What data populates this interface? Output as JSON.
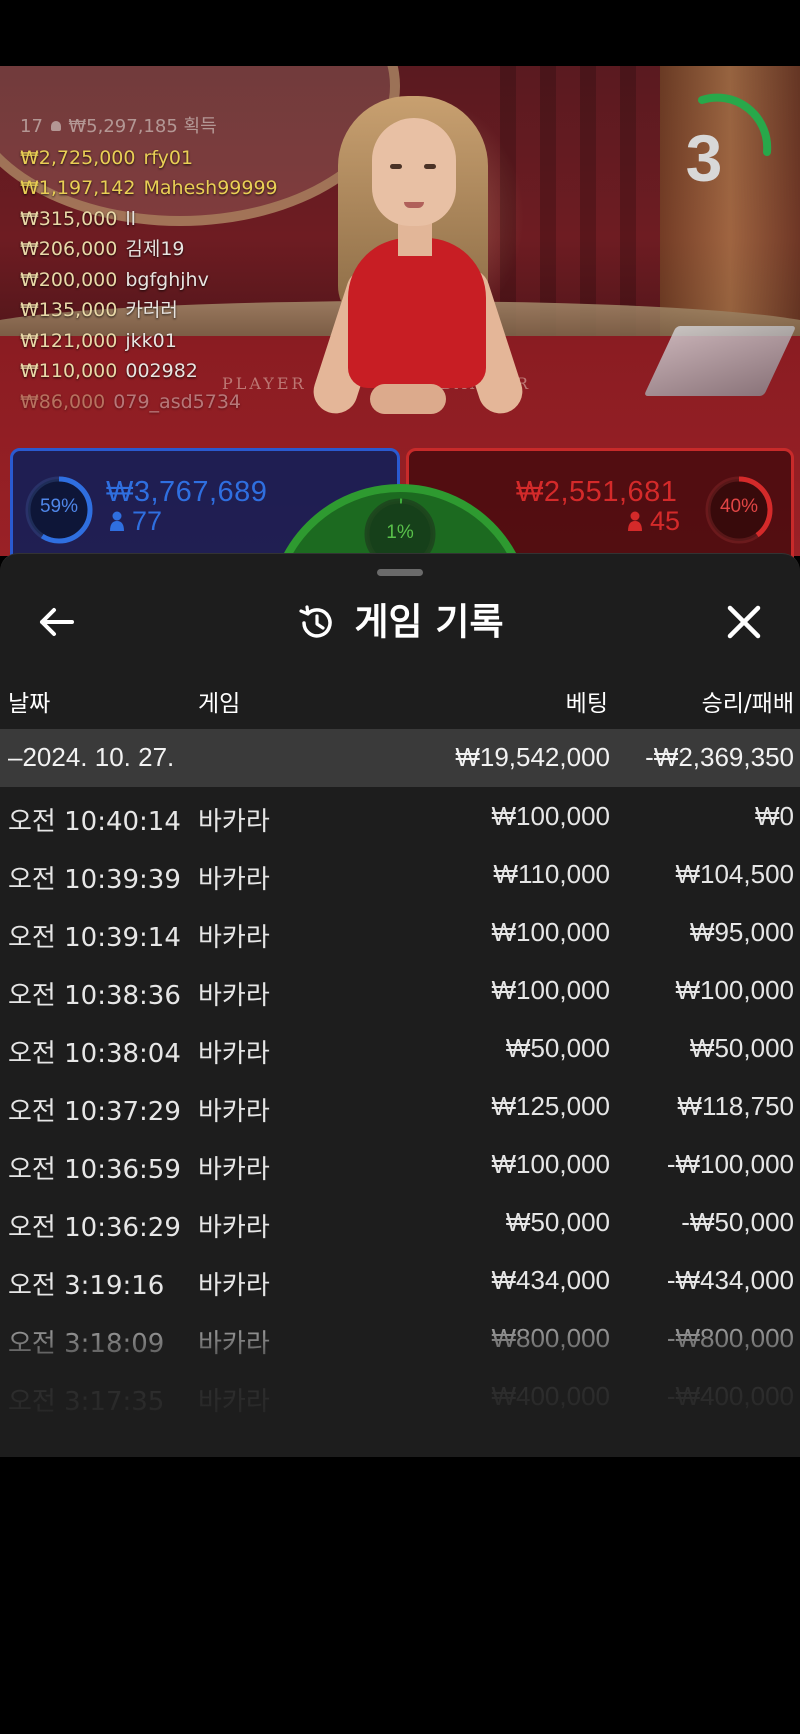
{
  "stream": {
    "timer_value": "3",
    "felt_player": "PLAYER",
    "felt_banker": "BANKER",
    "bets_header": {
      "count": "17",
      "total": "₩5,297,185",
      "suffix": "획득"
    },
    "bets": [
      {
        "amount": "₩2,725,000",
        "name": "rfy01",
        "highlight": true
      },
      {
        "amount": "₩1,197,142",
        "name": "Mahesh99999",
        "highlight": true
      },
      {
        "amount": "₩315,000",
        "name": "ll",
        "highlight": false
      },
      {
        "amount": "₩206,000",
        "name": "김제19",
        "highlight": false
      },
      {
        "amount": "₩200,000",
        "name": "bgfghjhv",
        "highlight": false
      },
      {
        "amount": "₩135,000",
        "name": "카러러",
        "highlight": false
      },
      {
        "amount": "₩121,000",
        "name": "jkk01",
        "highlight": false
      },
      {
        "amount": "₩110,000",
        "name": "002982",
        "highlight": false
      },
      {
        "amount": "₩86,000",
        "name": "079_asd5734",
        "highlight": false
      }
    ],
    "player": {
      "percent": "59%",
      "percent_value": 59,
      "amount": "₩3,767,689",
      "count": "77",
      "color": "#2f6fe0"
    },
    "banker": {
      "percent": "40%",
      "percent_value": 40,
      "amount": "₩2,551,681",
      "count": "45",
      "color": "#d42a2a"
    },
    "tie": {
      "percent": "1%",
      "percent_value": 1,
      "color": "#3fae3a"
    }
  },
  "sheet": {
    "title": "게임 기록",
    "columns": {
      "date": "날짜",
      "game": "게임",
      "bet": "베팅",
      "win_loss": "승리/패배"
    },
    "day": {
      "date": "–2024. 10. 27.",
      "bet": "₩19,542,000",
      "win_loss": "-₩2,369,350"
    },
    "records": [
      {
        "time": "오전 10:40:14",
        "game": "바카라",
        "bet": "₩100,000",
        "win_loss": "₩0"
      },
      {
        "time": "오전 10:39:39",
        "game": "바카라",
        "bet": "₩110,000",
        "win_loss": "₩104,500"
      },
      {
        "time": "오전 10:39:14",
        "game": "바카라",
        "bet": "₩100,000",
        "win_loss": "₩95,000"
      },
      {
        "time": "오전 10:38:36",
        "game": "바카라",
        "bet": "₩100,000",
        "win_loss": "₩100,000"
      },
      {
        "time": "오전 10:38:04",
        "game": "바카라",
        "bet": "₩50,000",
        "win_loss": "₩50,000"
      },
      {
        "time": "오전 10:37:29",
        "game": "바카라",
        "bet": "₩125,000",
        "win_loss": "₩118,750"
      },
      {
        "time": "오전 10:36:59",
        "game": "바카라",
        "bet": "₩100,000",
        "win_loss": "-₩100,000"
      },
      {
        "time": "오전 10:36:29",
        "game": "바카라",
        "bet": "₩50,000",
        "win_loss": "-₩50,000"
      },
      {
        "time": "오전 3:19:16",
        "game": "바카라",
        "bet": "₩434,000",
        "win_loss": "-₩434,000"
      },
      {
        "time": "오전 3:18:09",
        "game": "바카라",
        "bet": "₩800,000",
        "win_loss": "-₩800,000"
      },
      {
        "time": "오전 3:17:35",
        "game": "바카라",
        "bet": "₩400,000",
        "win_loss": "-₩400,000"
      }
    ],
    "icons": {
      "back": "arrow-left-icon",
      "history": "history-icon",
      "close": "close-icon"
    }
  }
}
